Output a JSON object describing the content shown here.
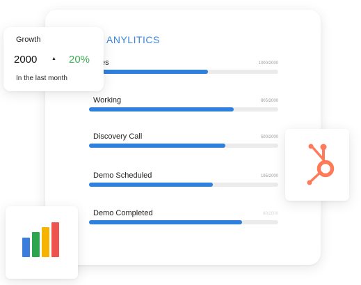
{
  "main": {
    "title": "I ANYLITICS",
    "rows": [
      {
        "label": "plies",
        "count": "1000/2000",
        "progress": 0.63
      },
      {
        "label": "Working",
        "count": "805/2000",
        "progress": 0.765
      },
      {
        "label": "Discovery Call",
        "count": "500/2000",
        "progress": 0.72
      },
      {
        "label": "Demo Scheduled",
        "count": "195/2000",
        "progress": 0.655
      },
      {
        "label": "Demo Completed",
        "count": "80/2000",
        "progress": 0.81
      }
    ]
  },
  "growth": {
    "title": "Growth",
    "value": "2000",
    "arrow": "▲",
    "percent": "20%",
    "subtitle": "In the last month"
  },
  "icons": {
    "hubspot": "hubspot-logo-icon",
    "bar_chart": "bar-chart-icon"
  },
  "colors": {
    "accent": "#3b86d8",
    "progress": "#2f7fdc",
    "positive": "#3fae55",
    "hubspot": "#ff7a59",
    "bar_blue": "#3b7ddd",
    "bar_green": "#2da44e",
    "bar_yellow": "#f5b400",
    "bar_red": "#ef5350"
  }
}
